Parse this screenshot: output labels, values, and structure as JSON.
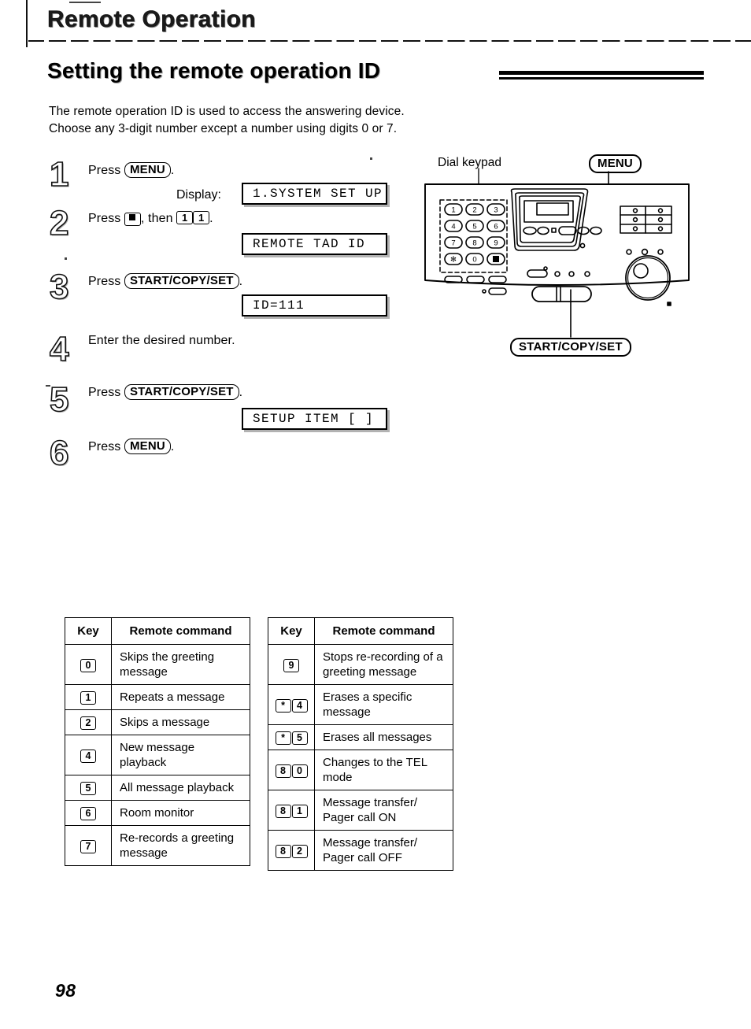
{
  "header": {
    "chapter": "Remote Operation",
    "section": "Setting the remote operation ID"
  },
  "intro": {
    "line1": "The remote operation ID is used to access the answering device.",
    "line2": "Choose any 3-digit number except a number using digits 0 or 7."
  },
  "steps": [
    {
      "number": "1",
      "prefix": "Press",
      "button": "MENU",
      "suffix": ".",
      "display_label": "Display:",
      "lcd": "1.SYSTEM SET UP"
    },
    {
      "number": "2",
      "prefix": "Press",
      "key1": "#",
      "mid": ", then",
      "key2": "1",
      "key3": "1",
      "suffix": ".",
      "lcd": "REMOTE TAD ID"
    },
    {
      "number": "3",
      "prefix": "Press",
      "button": "START/COPY/SET",
      "suffix": ".",
      "lcd": "ID=111"
    },
    {
      "number": "4",
      "text": "Enter the desired number."
    },
    {
      "number": "5",
      "prefix": "Press",
      "button": "START/COPY/SET",
      "suffix": ".",
      "lcd": "SETUP ITEM [    ]"
    },
    {
      "number": "6",
      "prefix": "Press",
      "button": "MENU",
      "suffix": "."
    }
  ],
  "diagram": {
    "keypad_label": "Dial keypad",
    "menu_callout": "MENU",
    "start_callout": "START/COPY/SET",
    "keypad_keys": [
      "1",
      "2",
      "3",
      "4",
      "5",
      "6",
      "7",
      "8",
      "9",
      "*",
      "0",
      "#"
    ]
  },
  "tables": [
    {
      "headers": [
        "Key",
        "Remote command"
      ],
      "rows": [
        {
          "keys": [
            "0"
          ],
          "command": "Skips the greeting message"
        },
        {
          "keys": [
            "1"
          ],
          "command": "Repeats a message"
        },
        {
          "keys": [
            "2"
          ],
          "command": "Skips a message"
        },
        {
          "keys": [
            "4"
          ],
          "command": "New message playback"
        },
        {
          "keys": [
            "5"
          ],
          "command": "All message playback"
        },
        {
          "keys": [
            "6"
          ],
          "command": "Room monitor"
        },
        {
          "keys": [
            "7"
          ],
          "command": "Re-records a greeting message"
        }
      ]
    },
    {
      "headers": [
        "Key",
        "Remote command"
      ],
      "rows": [
        {
          "keys": [
            "9"
          ],
          "command": "Stops re-recording of a greeting message"
        },
        {
          "keys": [
            "*",
            "4"
          ],
          "command": "Erases a specific message"
        },
        {
          "keys": [
            "*",
            "5"
          ],
          "command": "Erases all messages"
        },
        {
          "keys": [
            "8",
            "0"
          ],
          "command": "Changes to the TEL mode"
        },
        {
          "keys": [
            "8",
            "1"
          ],
          "command": "Message transfer/ Pager call ON"
        },
        {
          "keys": [
            "8",
            "2"
          ],
          "command": "Message transfer/ Pager call OFF"
        }
      ]
    }
  ],
  "footer": {
    "page_number": "98"
  },
  "colors": {
    "ink": "#000000",
    "paper": "#ffffff"
  }
}
